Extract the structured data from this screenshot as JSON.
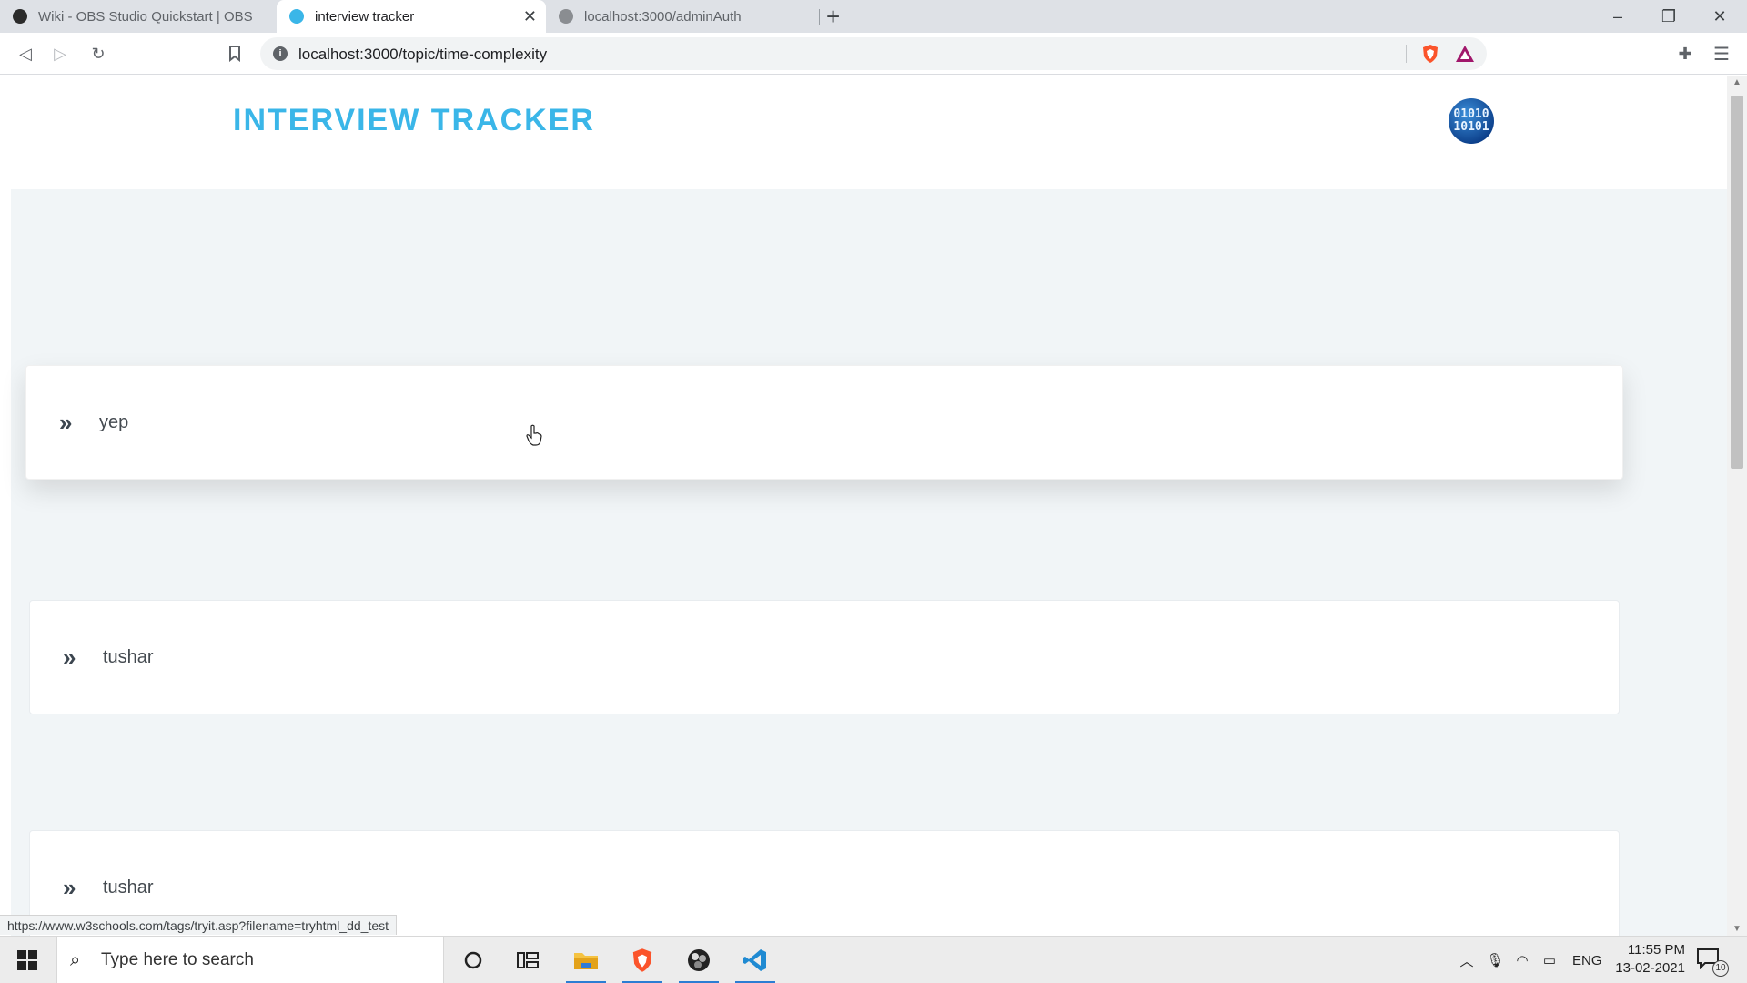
{
  "browser": {
    "tabs": [
      {
        "title": "Wiki - OBS Studio Quickstart | OBS",
        "active": false
      },
      {
        "title": "interview tracker",
        "active": true
      },
      {
        "title": "localhost:3000/adminAuth",
        "active": false
      }
    ],
    "new_tab_icon": "plus-icon",
    "url": "localhost:3000/topic/time-complexity",
    "window_controls": {
      "minimize": "–",
      "maximize": "❐",
      "close": "✕"
    }
  },
  "page": {
    "site_title": "INTERVIEW TRACKER",
    "avatar_text": [
      "01010",
      "10101"
    ],
    "items": [
      {
        "chevron": "»",
        "text": "yep"
      },
      {
        "chevron": "»",
        "text": "tushar"
      },
      {
        "chevron": "»",
        "text": "tushar"
      }
    ],
    "accent_color": "#3ab6e8",
    "background_color": "#f1f5f7"
  },
  "status_bar": {
    "link_preview": "https://www.w3schools.com/tags/tryit.asp?filename=tryhtml_dd_test"
  },
  "taskbar": {
    "search_placeholder": "Type here to search",
    "tray_language": "ENG",
    "time": "11:55 PM",
    "date": "13-02-2021",
    "notification_count": "10"
  }
}
